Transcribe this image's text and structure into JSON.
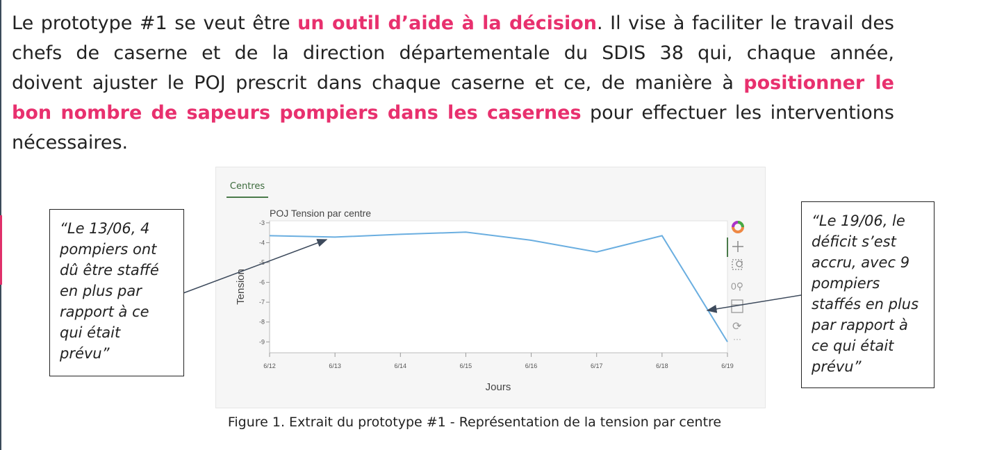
{
  "paragraph": {
    "lines": [
      [
        {
          "t": "Le prototype #1 se veut être "
        },
        {
          "t": "un outil d’aide à la décision",
          "hl": true
        },
        {
          "t": ". Il vise à faciliter le travail des"
        }
      ],
      [
        {
          "t": "chefs de caserne et de la direction départementale du SDIS 38 qui, chaque année,"
        }
      ],
      [
        {
          "t": "doivent ajuster le POJ prescrit dans chaque caserne et ce, de manière à "
        },
        {
          "t": "positionner le",
          "hl": true
        }
      ],
      [
        {
          "t": "bon nombre de sapeurs pompiers dans les casernes",
          "hl": true
        },
        {
          "t": " pour effectuer les interventions"
        }
      ],
      [
        {
          "t": "nécessaires."
        }
      ]
    ],
    "highlight_color": "#e8306e"
  },
  "panel": {
    "tab_label": "Centres"
  },
  "toolbar": {
    "icons": [
      "bokeh-logo-icon",
      "pan-icon",
      "box-zoom-icon",
      "wheel-zoom-icon",
      "save-icon",
      "reset-icon",
      "more-icon"
    ]
  },
  "callouts": {
    "left": "“Le 13/06, 4 pompiers ont dû être staffé en plus par rapport à ce qui était prévu”",
    "right": "“Le 19/06, le déficit s’est accru, avec 9 pompiers staffés en plus par rapport à ce qui était prévu”"
  },
  "caption": "Figure 1. Extrait du prototype #1 - Représentation de la tension par centre",
  "chart_data": {
    "type": "line",
    "title": "POJ Tension par centre",
    "xlabel": "Jours",
    "ylabel": "Tension",
    "categories": [
      "6/12",
      "6/13",
      "6/14",
      "6/15",
      "6/16",
      "6/17",
      "6/18",
      "6/19"
    ],
    "values": [
      -3.65,
      -3.72,
      -3.58,
      -3.47,
      -3.88,
      -4.47,
      -3.65,
      -9.0
    ],
    "yticks": [
      -3,
      -4,
      -5,
      -6,
      -7,
      -8,
      -9
    ],
    "ylim": [
      -9.55,
      -2.9
    ],
    "line_color": "#6aaee0",
    "grid": false
  }
}
